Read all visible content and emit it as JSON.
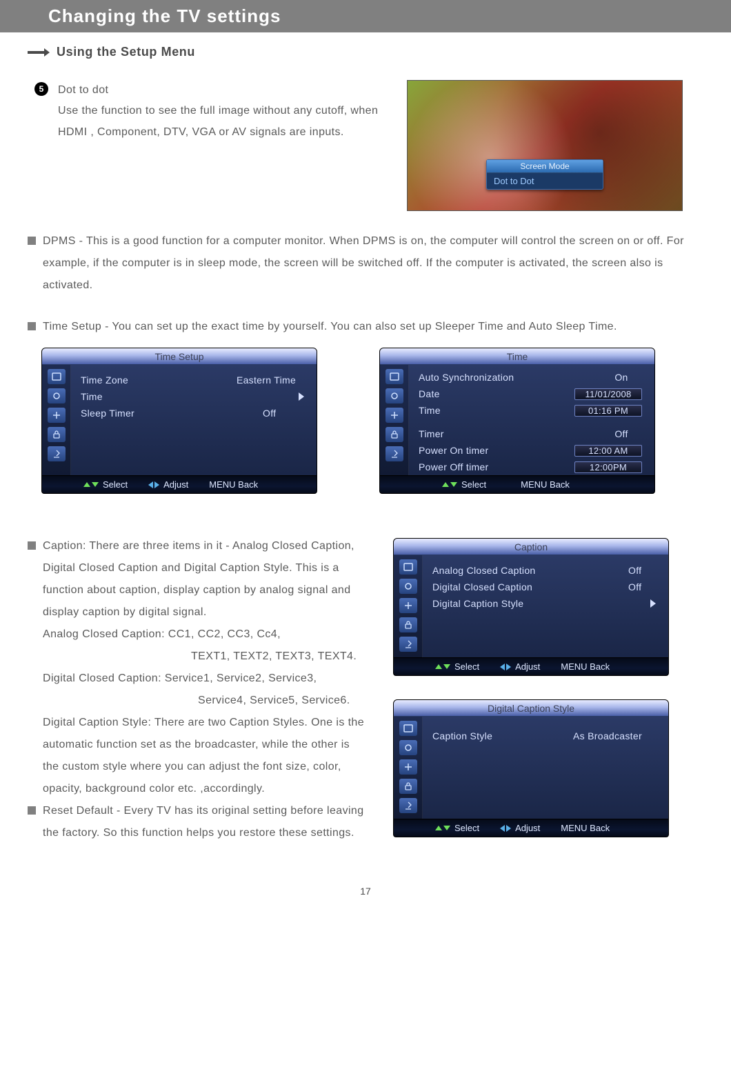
{
  "header": {
    "title": "Changing the TV settings"
  },
  "section": {
    "using_setup_menu": "Using the Setup Menu"
  },
  "step": {
    "num": "5",
    "title": "Dot  to  dot",
    "body": "Use the function to see the full image without any cutoff,  when HDMI , Component, DTV,  VGA or AV signals  are inputs."
  },
  "photo_osd": {
    "label": "Screen Mode",
    "value": "Dot to Dot"
  },
  "dpms": "DPMS  -  This is a good function for a computer monitor.  When DPMS is on,  the computer will control the screen on or off.  For example,  if the computer is in sleep mode,  the screen will be switched off.  If the computer is activated,  the screen also is activated.",
  "timesetup_text": "Time Setup  -  You can set up the exact time by yourself.  You can also set up Sleeper Time and Auto Sleep Time.",
  "osd_footer": {
    "select": "Select",
    "adjust": "Adjust",
    "menu_back": "MENU  Back"
  },
  "panel_time_setup": {
    "title": "Time Setup",
    "rows": [
      {
        "label": "Time Zone",
        "value": "Eastern Time"
      },
      {
        "label": "Time",
        "arrow": true
      },
      {
        "label": "Sleep Timer",
        "value": "Off"
      }
    ]
  },
  "panel_time": {
    "title": "Time",
    "rows": [
      {
        "label": "Auto Synchronization",
        "value": "On"
      },
      {
        "label": "Date",
        "boxed": "11/01/2008"
      },
      {
        "label": "Time",
        "boxed": "01:16 PM"
      },
      {
        "spacer": true
      },
      {
        "label": "Timer",
        "value": "Off"
      },
      {
        "label": "Power On timer",
        "boxed": "12:00 AM"
      },
      {
        "label": "Power Off timer",
        "boxed": "12:00PM"
      }
    ]
  },
  "caption_text": {
    "p1": "Caption:  There are three items in it  -  Analog Closed Caption,  Digital Closed Caption and Digital Caption Style.  This is a function about caption, display caption by analog signal and display caption by digital signal.",
    "acc_line1": "Analog Closed Caption:  CC1,  CC2,  CC3,  Cc4,",
    "acc_line2": "TEXT1, TEXT2, TEXT3, TEXT4.",
    "dcc_line1": "Digital Closed Caption:  Service1,  Service2,  Service3,",
    "dcc_line2": "Service4,  Service5,  Service6.",
    "dcs": "Digital Caption Style:  There are two Caption Styles.  One is the automatic function set as the broadcaster,  while the other is the custom style where you can adjust the font size,  color,  opacity,  background color etc.  ,accordingly."
  },
  "reset_text": "Reset Default -   Every TV has its original setting before leaving the factory.  So this function helps you restore these settings.",
  "panel_caption": {
    "title": "Caption",
    "rows": [
      {
        "label": "Analog Closed Caption",
        "value": "Off"
      },
      {
        "label": "Digital Closed Caption",
        "value": "Off"
      },
      {
        "label": "Digital Caption Style",
        "arrow": true
      }
    ]
  },
  "panel_dcs": {
    "title": "Digital Caption Style",
    "rows": [
      {
        "label": "Caption Style",
        "value": "As Broadcaster"
      }
    ]
  },
  "pagenum": "17"
}
